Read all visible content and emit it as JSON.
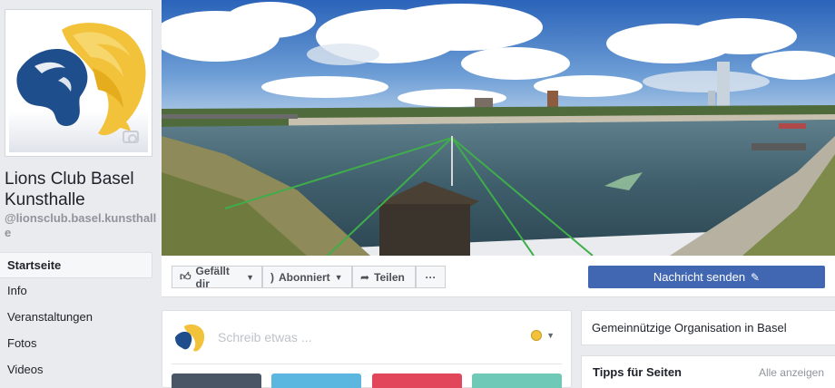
{
  "page": {
    "name": "Lions Club Basel Kunsthalle",
    "handle": "@lionsclub.basel.kunsthalle"
  },
  "nav": {
    "items": [
      {
        "label": "Startseite",
        "active": true
      },
      {
        "label": "Info"
      },
      {
        "label": "Veranstaltungen"
      },
      {
        "label": "Fotos"
      },
      {
        "label": "Videos"
      }
    ]
  },
  "actions": {
    "like_label": "Gefällt dir",
    "follow_label": "Abonniert",
    "share_label": "Teilen",
    "more_label": "···",
    "message_label": "Nachricht senden"
  },
  "composer": {
    "placeholder": "Schreib etwas ..."
  },
  "sidebar": {
    "category": "Gemeinnützige Organisation in Basel",
    "tips_title": "Tipps für Seiten",
    "tips_link": "Alle anzeigen"
  },
  "colors": {
    "primary": "#4267b2",
    "background": "#e9ebee",
    "logo_gold": "#f3c23b",
    "logo_blue": "#1f4e8c"
  }
}
